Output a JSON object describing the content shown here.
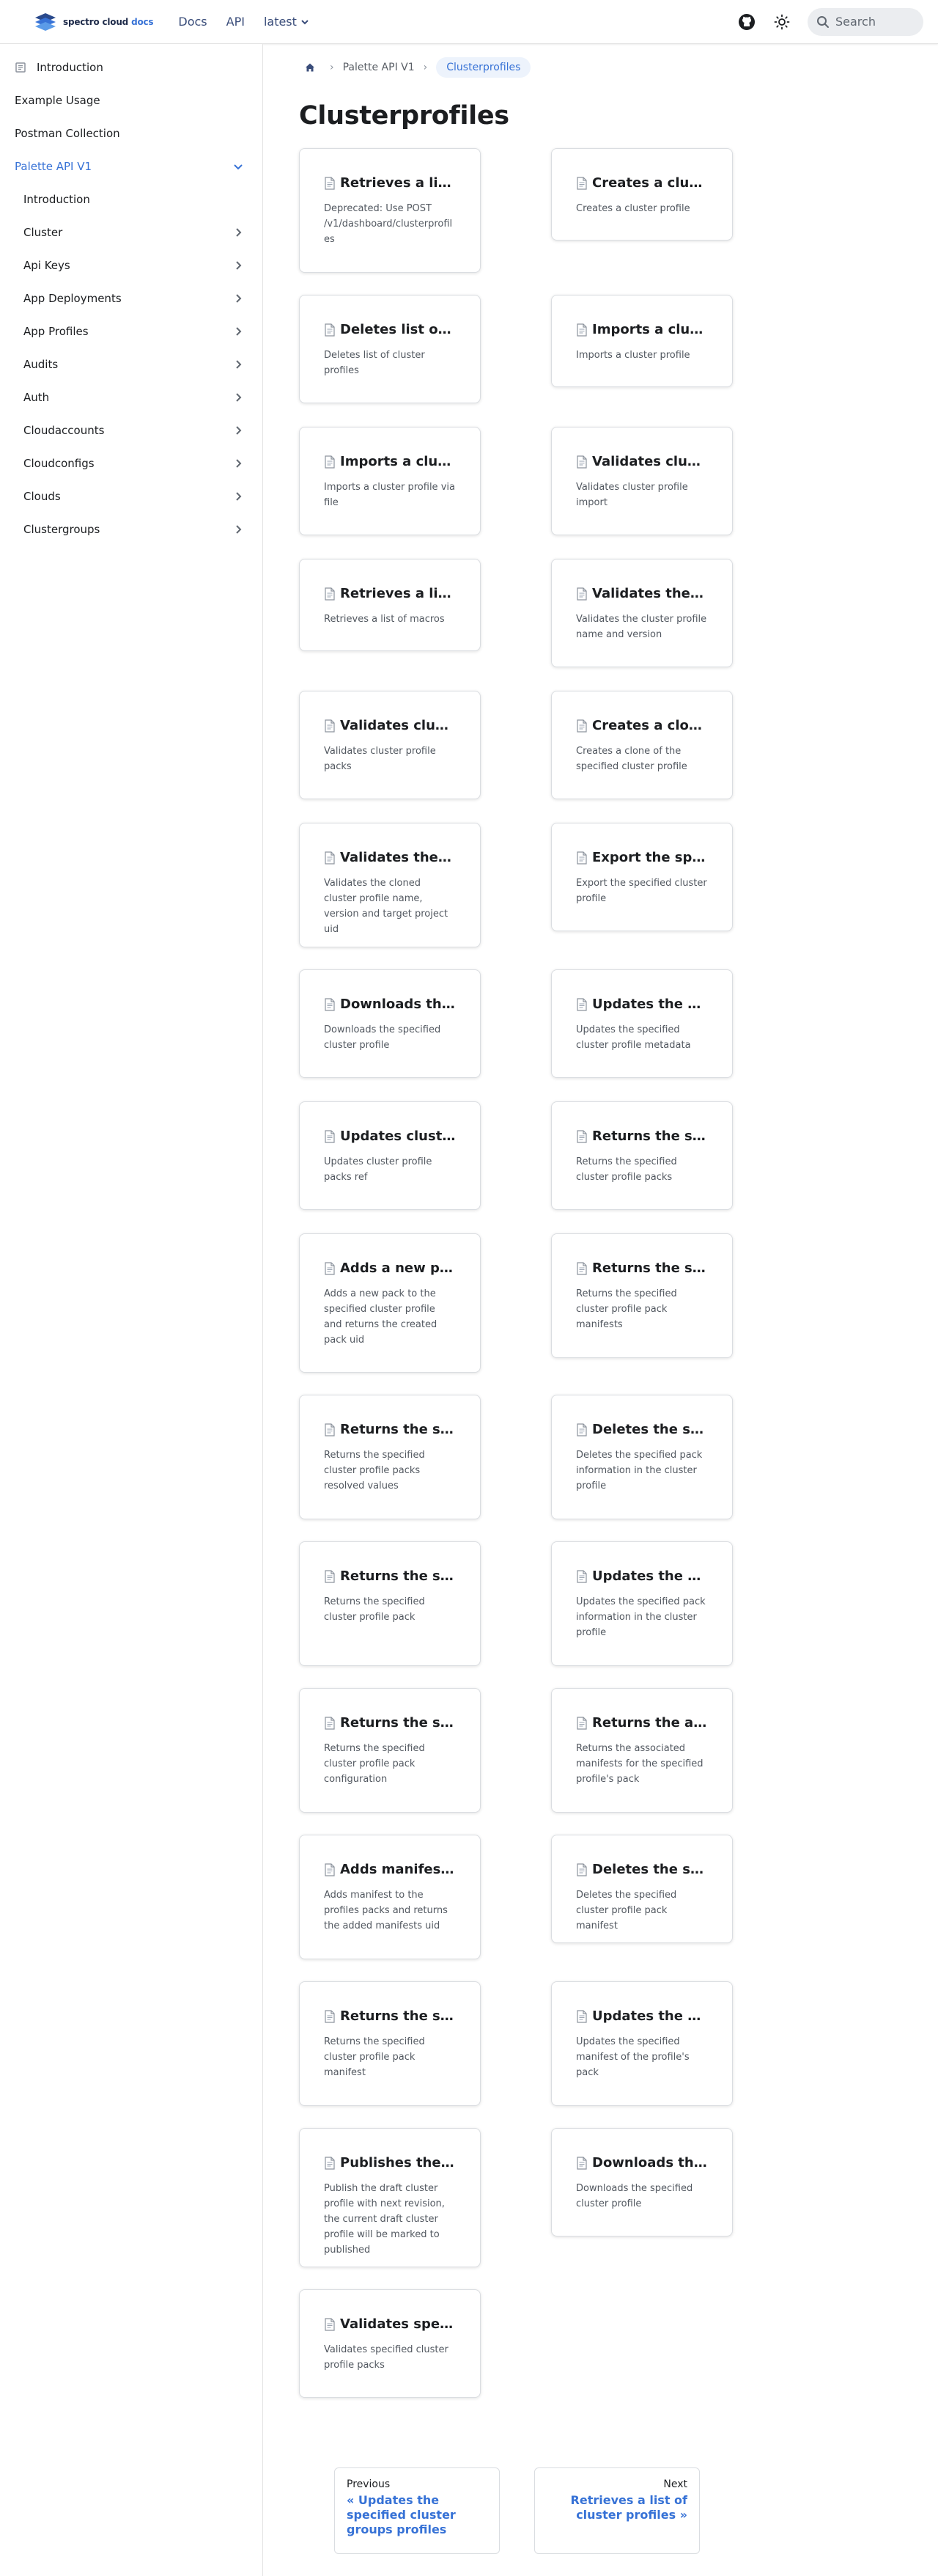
{
  "navbar": {
    "brand": "spectro cloud",
    "brand_docs": "docs",
    "links": [
      "Docs",
      "API"
    ],
    "version": "latest",
    "search_placeholder": "Search"
  },
  "sidebar": {
    "items": [
      {
        "label": "Introduction"
      },
      {
        "label": "Example Usage"
      },
      {
        "label": "Postman Collection"
      },
      {
        "label": "Palette API V1"
      },
      {
        "label": "Introduction"
      },
      {
        "label": "Cluster"
      },
      {
        "label": "Api Keys"
      },
      {
        "label": "App Deployments"
      },
      {
        "label": "App Profiles"
      },
      {
        "label": "Audits"
      },
      {
        "label": "Auth"
      },
      {
        "label": "Cloudaccounts"
      },
      {
        "label": "Cloudconfigs"
      },
      {
        "label": "Clouds"
      },
      {
        "label": "Clustergroups"
      }
    ]
  },
  "breadcrumbs": [
    "Palette API V1",
    "Clusterprofiles"
  ],
  "page_title": "Clusterprofiles",
  "cards": [
    {
      "title": "Retrieves a list of cluster profiles",
      "desc": "Deprecated: Use POST /v1/dashboard/clusterprofiles"
    },
    {
      "title": "Creates a cluster profile",
      "desc": "Creates a cluster profile"
    },
    {
      "title": "Deletes list of cluster profiles",
      "desc": "Deletes list of cluster profiles"
    },
    {
      "title": "Imports a cluster profile",
      "desc": "Imports a cluster profile"
    },
    {
      "title": "Imports a cluster profile via file",
      "desc": "Imports a cluster profile via file"
    },
    {
      "title": "Validates cluster profile import",
      "desc": "Validates cluster profile import"
    },
    {
      "title": "Retrieves a list of macros",
      "desc": "Retrieves a list of macros"
    },
    {
      "title": "Validates the cluster profile name and version",
      "desc": "Validates the cluster profile name and version"
    },
    {
      "title": "Validates cluster profile packs",
      "desc": "Validates cluster profile packs"
    },
    {
      "title": "Creates a clone of the specified cluster profile",
      "desc": "Creates a clone of the specified cluster profile"
    },
    {
      "title": "Validates the cloned cluster profile name",
      "desc": "Validates the cloned cluster profile name, version and target project uid"
    },
    {
      "title": "Export the specified cluster profile",
      "desc": "Export the specified cluster profile"
    },
    {
      "title": "Downloads the specified cluster profile",
      "desc": "Downloads the specified cluster profile"
    },
    {
      "title": "Updates the specified cluster profile metadata",
      "desc": "Updates the specified cluster profile metadata"
    },
    {
      "title": "Updates cluster profile packs ref",
      "desc": "Updates cluster profile packs ref"
    },
    {
      "title": "Returns the specified cluster profile packs",
      "desc": "Returns the specified cluster profile packs"
    },
    {
      "title": "Adds a new pack to the specified cluster profile",
      "desc": "Adds a new pack to the specified cluster profile and returns the created pack uid"
    },
    {
      "title": "Returns the specified cluster profile pack manifests",
      "desc": "Returns the specified cluster profile pack manifests"
    },
    {
      "title": "Returns the specified cluster profile packs resolved values",
      "desc": "Returns the specified cluster profile packs resolved values"
    },
    {
      "title": "Deletes the specified pack information",
      "desc": "Deletes the specified pack information in the cluster profile"
    },
    {
      "title": "Returns the specified cluster profile pack",
      "desc": "Returns the specified cluster profile pack"
    },
    {
      "title": "Updates the specified pack information",
      "desc": "Updates the specified pack information in the cluster profile"
    },
    {
      "title": "Returns the specified cluster profile pack configuration",
      "desc": "Returns the specified cluster profile pack configuration"
    },
    {
      "title": "Returns the associated manifests",
      "desc": "Returns the associated manifests for the specified profile's pack"
    },
    {
      "title": "Adds manifest to the profiles packs",
      "desc": "Adds manifest to the profiles packs and returns the added manifests uid"
    },
    {
      "title": "Deletes the specified cluster profile pack manifest",
      "desc": "Deletes the specified cluster profile pack manifest"
    },
    {
      "title": "Returns the specified cluster profile pack manifest",
      "desc": "Returns the specified cluster profile pack manifest"
    },
    {
      "title": "Updates the specified manifest of the profile's pack",
      "desc": "Updates the specified manifest of the profile's pack"
    },
    {
      "title": "Publishes the specified cluster profile",
      "desc": "Publish the draft cluster profile with next revision, the current draft cluster profile will be marked to published"
    },
    {
      "title": "Downloads the specified cluster profile",
      "desc": "Downloads the specified cluster profile"
    },
    {
      "title": "Validates specified cluster profile packs",
      "desc": "Validates specified cluster profile packs"
    }
  ],
  "pager": {
    "prev_sub": "Previous",
    "prev_label": "« Updates the specified cluster groups profiles",
    "next_sub": "Next",
    "next_label": "Retrieves a list of cluster profiles »"
  },
  "colors": {
    "accent": "#3772d6",
    "brand_dark": "#1e2b4a",
    "border": "#dadde1"
  }
}
